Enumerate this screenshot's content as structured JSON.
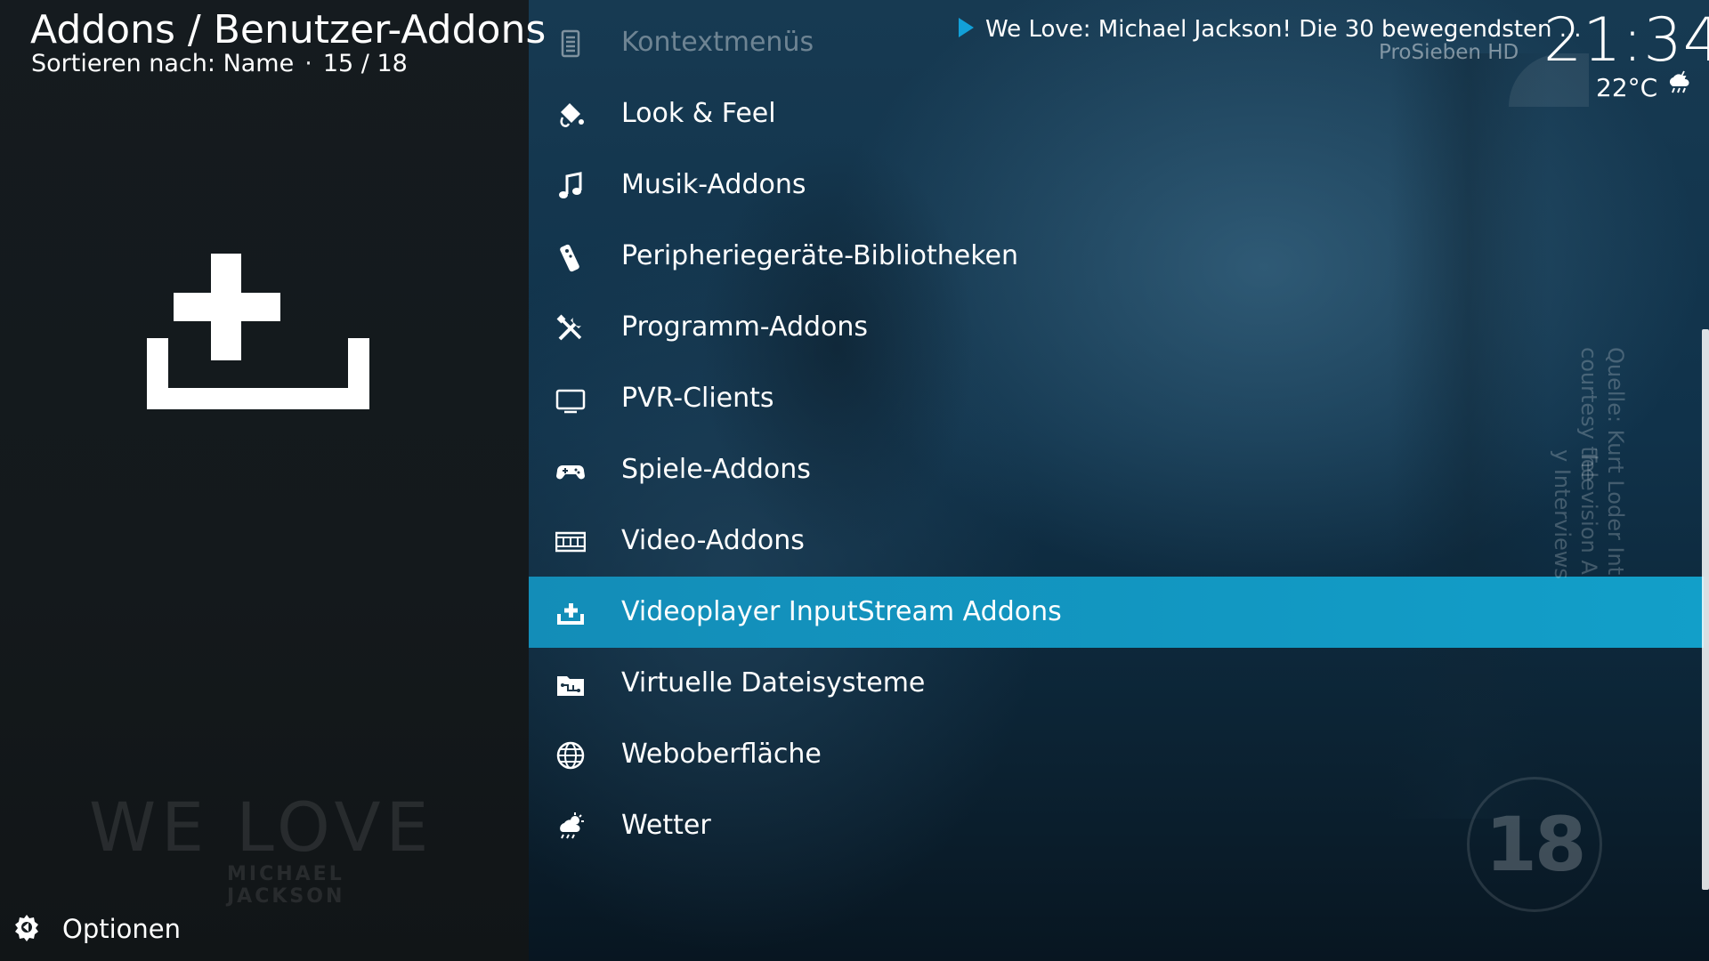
{
  "header": {
    "title": "Addons / Benutzer-Addons",
    "sort_label": "Sortieren nach: Name",
    "separator": "·",
    "position": "15 / 18"
  },
  "selected_icon": "install-addon-icon",
  "watermark": {
    "main": "WE LOVE",
    "sub": "MICHAEL JACKSON"
  },
  "footer": {
    "options_label": "Optionen",
    "options_icon": "options-gear-icon"
  },
  "now_playing": {
    "title": "We Love: Michael Jackson! Die 30 bewegendsten ...",
    "channel": "ProSieben HD",
    "play_icon": "play-icon"
  },
  "clock": {
    "time": "21:34",
    "temperature": "22°C",
    "weather_icon": "cloud-rain-icon"
  },
  "video_overlay": {
    "credit_line1": "Quelle: Kurt Loder Int",
    "credit_line2": "courtesy the",
    "credit_line3": "Television A",
    "credit_line4": "y Interviews",
    "age_rating": "18"
  },
  "list": {
    "items": [
      {
        "label": "Kontextmenüs",
        "icon": "context-menu-icon",
        "state": "dim"
      },
      {
        "label": "Look & Feel",
        "icon": "paint-bucket-icon",
        "state": "normal"
      },
      {
        "label": "Musik-Addons",
        "icon": "music-note-icon",
        "state": "normal"
      },
      {
        "label": "Peripheriegeräte-Bibliotheken",
        "icon": "remote-control-icon",
        "state": "normal"
      },
      {
        "label": "Programm-Addons",
        "icon": "tools-icon",
        "state": "normal"
      },
      {
        "label": "PVR-Clients",
        "icon": "tv-icon",
        "state": "normal"
      },
      {
        "label": "Spiele-Addons",
        "icon": "gamepad-icon",
        "state": "normal"
      },
      {
        "label": "Video-Addons",
        "icon": "film-strip-icon",
        "state": "normal"
      },
      {
        "label": "Videoplayer InputStream Addons",
        "icon": "install-addon-icon",
        "state": "focused"
      },
      {
        "label": "Virtuelle Dateisysteme",
        "icon": "filesystem-icon",
        "state": "normal"
      },
      {
        "label": "Weboberfläche",
        "icon": "globe-icon",
        "state": "normal"
      },
      {
        "label": "Wetter",
        "icon": "weather-icon",
        "state": "normal"
      }
    ]
  },
  "colors": {
    "focus": "#129fc9",
    "left_panel": "#151b1f",
    "accent_play": "#12a0d8"
  }
}
